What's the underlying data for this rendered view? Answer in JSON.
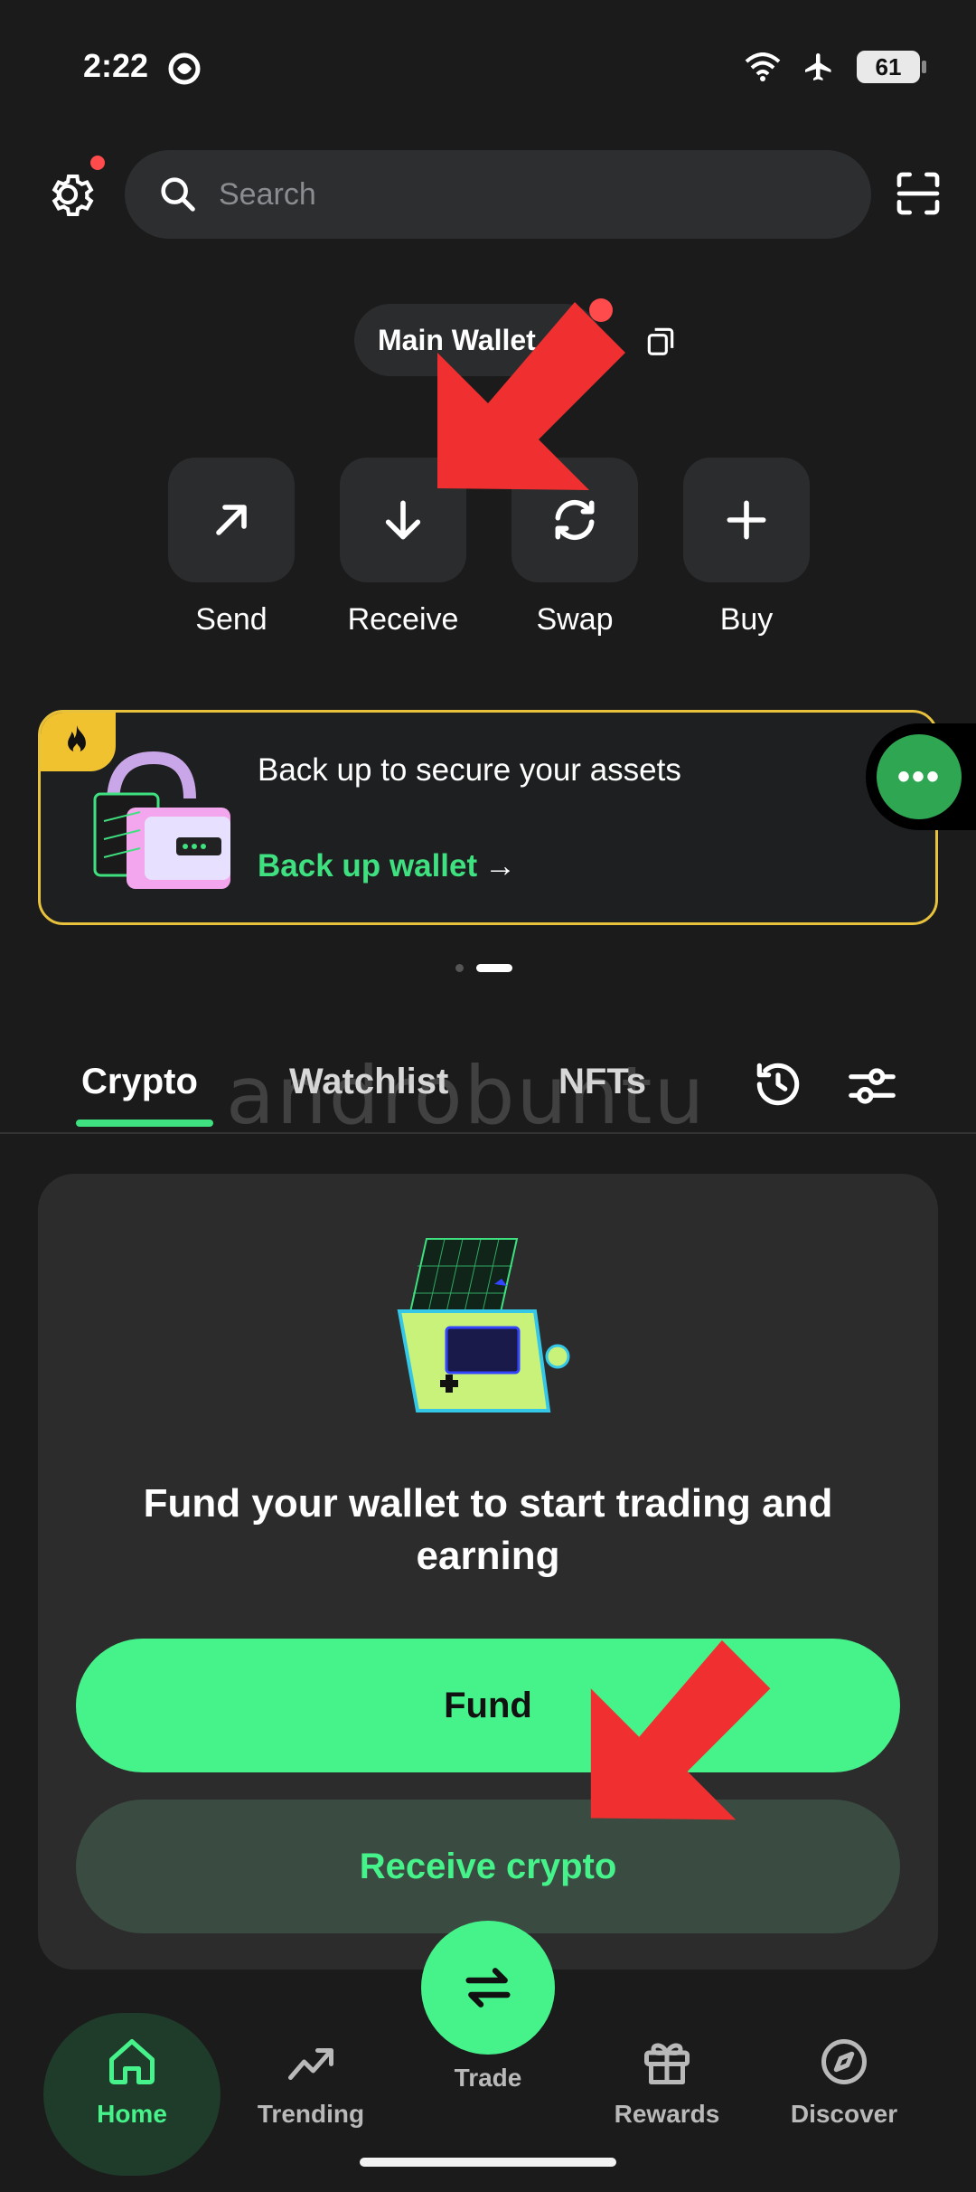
{
  "status_bar": {
    "time": "2:22",
    "battery": "61"
  },
  "search": {
    "placeholder": "Search"
  },
  "wallet": {
    "name": "Main Wallet"
  },
  "actions": [
    {
      "label": "Send",
      "icon": "arrow-up-right-icon"
    },
    {
      "label": "Receive",
      "icon": "arrow-down-icon"
    },
    {
      "label": "Swap",
      "icon": "refresh-icon"
    },
    {
      "label": "Buy",
      "icon": "plus-icon"
    }
  ],
  "banner": {
    "title": "Back up to secure your assets",
    "link": "Back up wallet",
    "arrow": "→"
  },
  "fab": {
    "label": "•••"
  },
  "tabs": [
    {
      "label": "Crypto",
      "active": true
    },
    {
      "label": "Watchlist",
      "active": false
    },
    {
      "label": "NFTs",
      "active": false
    }
  ],
  "watermark": "androbuntu",
  "fund_card": {
    "title": "Fund your wallet to start trading and earning",
    "fund_button": "Fund",
    "receive_button": "Receive crypto"
  },
  "nav": {
    "home": "Home",
    "trending": "Trending",
    "trade": "Trade",
    "rewards": "Rewards",
    "discover": "Discover"
  },
  "colors": {
    "accent": "#46f38a",
    "background": "#1b1b1c",
    "banner_border": "#e8c23c",
    "alert_dot": "#ff4b4b",
    "annotation_arrow": "#f03030"
  }
}
